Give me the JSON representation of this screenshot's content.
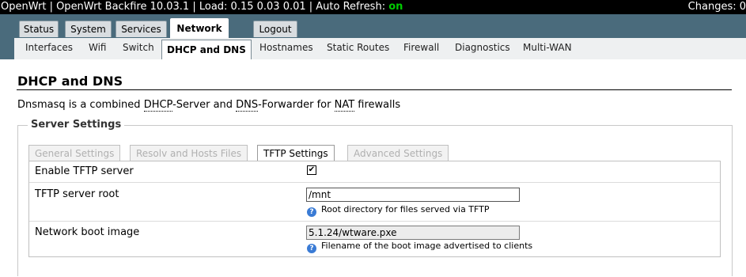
{
  "topbar": {
    "prefix": "OpenWrt | OpenWrt Backfire 10.03.1 | Load: 0.15 0.03 0.01 | Auto Refresh: ",
    "refresh_state": "on",
    "changes": "Changes: 0"
  },
  "main_tabs": [
    "Status",
    "System",
    "Services",
    "Network",
    "Logout"
  ],
  "sub_tabs": [
    "Interfaces",
    "Wifi",
    "Switch",
    "DHCP and DNS",
    "Hostnames",
    "Static Routes",
    "Firewall",
    "Diagnostics",
    "Multi-WAN"
  ],
  "page": {
    "title": "DHCP and DNS",
    "desc": {
      "p1": "Dnsmasq is a combined ",
      "dhcp": "DHCP",
      "p2": "-Server and ",
      "dns": "DNS",
      "p3": "-Forwarder for ",
      "nat": "NAT",
      "p4": " firewalls"
    }
  },
  "section": {
    "legend": "Server Settings",
    "tabs": [
      "General Settings",
      "Resolv and Hosts Files",
      "TFTP Settings",
      "Advanced Settings"
    ],
    "fields": {
      "enable_label": "Enable TFTP server",
      "enable_checked": "✔",
      "root_label": "TFTP server root",
      "root_value": "/mnt",
      "root_help": "Root directory for files served via TFTP",
      "boot_label": "Network boot image",
      "boot_value": "5.1.24/wtware.pxe",
      "boot_help": "Filename of the boot image advertised to clients"
    }
  },
  "colors": {
    "header": "#4a6b7c",
    "on": "#00cc00",
    "help_icon": "#3a7bd5"
  }
}
